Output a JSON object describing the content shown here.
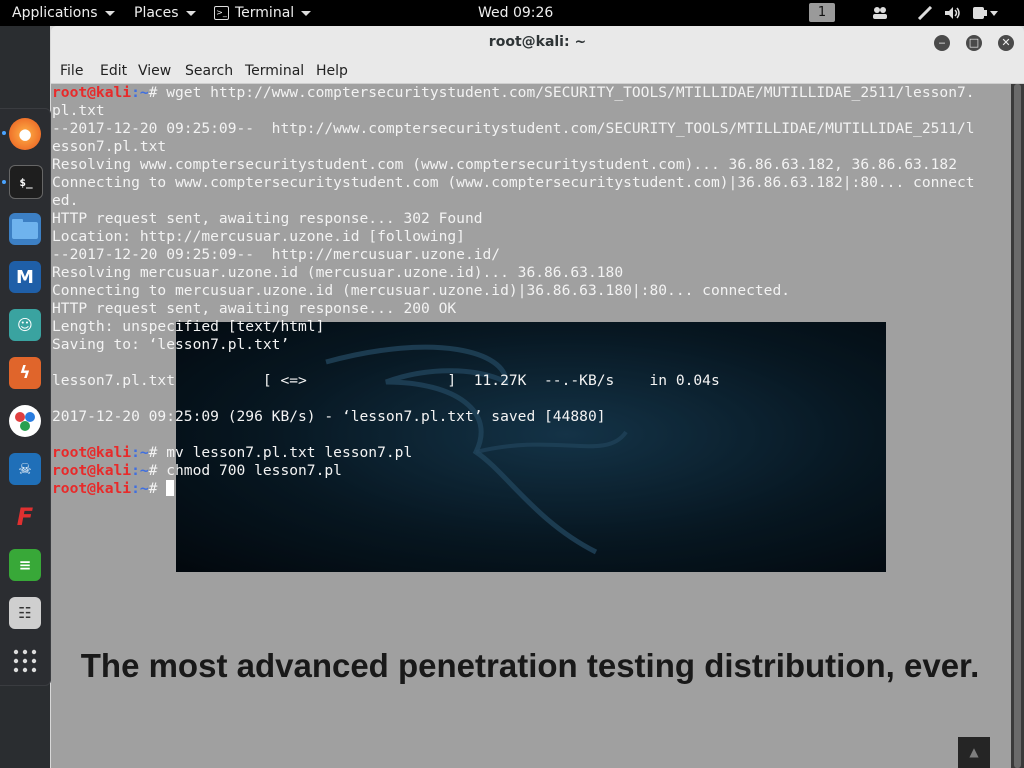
{
  "top_panel": {
    "applications": "Applications",
    "places": "Places",
    "terminal": "Terminal",
    "clock": "Wed 09:26",
    "workspace": "1",
    "icons": [
      "people-icon",
      "network-icon",
      "volume-icon",
      "power-icon"
    ]
  },
  "background": {
    "tagline": "The most advanced penetration testing distribution, ever."
  },
  "dock": {
    "items": [
      "firefox-icon",
      "terminal-icon",
      "files-icon",
      "metasploit-icon",
      "armitage-icon",
      "burpsuite-icon",
      "maltego-icon",
      "beef-icon",
      "faraday-icon",
      "leafpad-icon",
      "cherrytree-icon",
      "show-apps-icon"
    ]
  },
  "window": {
    "title": "root@kali: ~",
    "menu": [
      "File",
      "Edit",
      "View",
      "Search",
      "Terminal",
      "Help"
    ]
  },
  "terminal": {
    "prompt_user": "root@kali",
    "prompt_path": ":~",
    "prompt_sym": "# ",
    "cmd1": "wget http://www.comptersecuritystudent.com/SECURITY_TOOLS/MTILLIDAE/MUTILLIDAE_2511/lesson7.pl.txt",
    "output": [
      "--2017-12-20 09:25:09--  http://www.comptersecuritystudent.com/SECURITY_TOOLS/MTILLIDAE/MUTILLIDAE_2511/lesson7.pl.txt",
      "Resolving www.comptersecuritystudent.com (www.comptersecuritystudent.com)... 36.86.63.182, 36.86.63.182",
      "Connecting to www.comptersecuritystudent.com (www.comptersecuritystudent.com)|36.86.63.182|:80... connected.",
      "HTTP request sent, awaiting response... 302 Found",
      "Location: http://mercusuar.uzone.id [following]",
      "--2017-12-20 09:25:09--  http://mercusuar.uzone.id/",
      "Resolving mercusuar.uzone.id (mercusuar.uzone.id)... 36.86.63.180",
      "Connecting to mercusuar.uzone.id (mercusuar.uzone.id)|36.86.63.180|:80... connected.",
      "HTTP request sent, awaiting response... 200 OK",
      "Length: unspecified [text/html]",
      "Saving to: ‘lesson7.pl.txt’",
      "",
      "lesson7.pl.txt          [ <=>                ]  11.27K  --.-KB/s    in 0.04s",
      "",
      "2017-12-20 09:25:09 (296 KB/s) - ‘lesson7.pl.txt’ saved [44880]",
      ""
    ],
    "cmd2": "mv lesson7.pl.txt lesson7.pl",
    "cmd3": "chmod 700 lesson7.pl"
  }
}
